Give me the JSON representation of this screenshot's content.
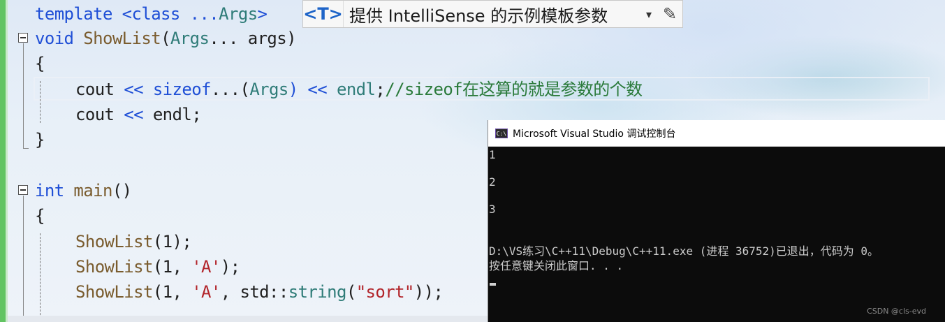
{
  "editor": {
    "lines": {
      "l1": {
        "a": "template",
        "b": " <class ...",
        "c": "Args",
        "d": ">"
      },
      "l2": {
        "a": "void",
        "b": " ",
        "c": "ShowList",
        "d": "(",
        "e": "Args",
        "f": "... args)"
      },
      "l3": {
        "a": "{"
      },
      "l4": {
        "a": "cout",
        "b": " << ",
        "c": "sizeof",
        "d": "...(",
        "e": "Args",
        "f": ") << ",
        "g": "endl",
        "h": ";",
        "i": "//sizeof在这算的就是参数的个数"
      },
      "l5": {
        "a": "cout",
        "b": " << ",
        "c": "endl",
        "d": ";"
      },
      "l6": {
        "a": "}"
      },
      "l8": {
        "a": "int",
        "b": " ",
        "c": "main",
        "d": "()"
      },
      "l9": {
        "a": "{"
      },
      "l10": {
        "a": "ShowList",
        "b": "(1);"
      },
      "l11": {
        "a": "ShowList",
        "b": "(1, ",
        "c": "'A'",
        "d": ");"
      },
      "l12": {
        "a": "ShowList",
        "b": "(1, ",
        "c": "'A'",
        "d": ", std::",
        "e": "string",
        "f": "(",
        "g": "\"sort\"",
        "h": "));"
      }
    }
  },
  "tooltip": {
    "tag": "<T>",
    "text": "提供 IntelliSense 的示例模板参数",
    "dropdown": "▾",
    "edit": "✎"
  },
  "console": {
    "icon": "C:\\",
    "title": "Microsoft Visual Studio 调试控制台",
    "output": [
      "1",
      "2",
      "3",
      "D:\\VS练习\\C++11\\Debug\\C++11.exe (进程 36752)已退出，代码为 0。",
      "按任意键关闭此窗口. . ."
    ]
  },
  "watermark": "CSDN @cls-evd",
  "colors": {
    "keyword": "#1f4fd6",
    "type": "#2f7c78",
    "function": "#7a5c2e",
    "string": "#b2242a",
    "comment": "#2a7a3a",
    "change_bar": "#62c462",
    "console_bg": "#0c0c0c"
  }
}
